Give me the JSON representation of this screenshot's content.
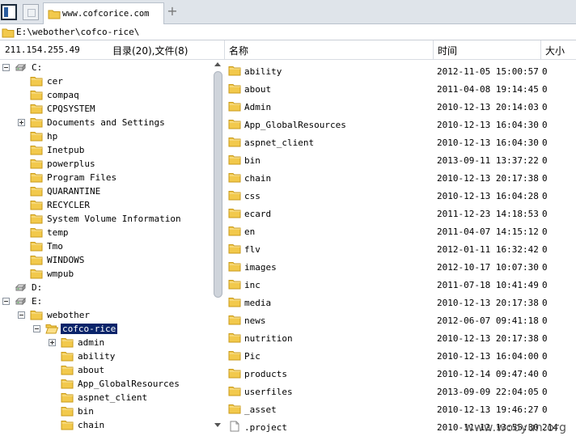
{
  "tab": {
    "title": "www.cofcorice.com",
    "add": "+"
  },
  "address": {
    "path": "E:\\webother\\cofco-rice\\"
  },
  "header": {
    "ip": "211.154.255.49",
    "counts": "目录(20),文件(8)",
    "col_name": "名称",
    "col_time": "时间",
    "col_size": "大小"
  },
  "tree": [
    {
      "label": "C:",
      "icon": "drive-icon",
      "x": 4,
      "level": 0,
      "expander": "minus"
    },
    {
      "label": "cer",
      "icon": "folder-icon",
      "level": 1
    },
    {
      "label": "compaq",
      "icon": "folder-icon",
      "level": 1
    },
    {
      "label": "CPQSYSTEM",
      "icon": "folder-icon",
      "level": 1
    },
    {
      "label": "Documents and Settings",
      "icon": "folder-icon",
      "level": 1,
      "expander": "plus"
    },
    {
      "label": "hp",
      "icon": "folder-icon",
      "level": 1
    },
    {
      "label": "Inetpub",
      "icon": "folder-icon",
      "level": 1
    },
    {
      "label": "powerplus",
      "icon": "folder-icon",
      "level": 1
    },
    {
      "label": "Program Files",
      "icon": "folder-icon",
      "level": 1
    },
    {
      "label": "QUARANTINE",
      "icon": "folder-icon",
      "level": 1
    },
    {
      "label": "RECYCLER",
      "icon": "folder-icon",
      "level": 1
    },
    {
      "label": "System Volume Information",
      "icon": "folder-icon",
      "level": 1
    },
    {
      "label": "temp",
      "icon": "folder-icon",
      "level": 1
    },
    {
      "label": "Tmo",
      "icon": "folder-icon",
      "level": 1
    },
    {
      "label": "WINDOWS",
      "icon": "folder-icon",
      "level": 1
    },
    {
      "label": "wmpub",
      "icon": "folder-icon",
      "level": 1
    },
    {
      "label": "D:",
      "icon": "drive-icon",
      "level": 0
    },
    {
      "label": "E:",
      "icon": "drive-icon",
      "level": 0,
      "expander": "minus"
    },
    {
      "label": "webother",
      "icon": "folder-icon",
      "level": 1,
      "expander": "minus"
    },
    {
      "label": "cofco-rice",
      "icon": "open-folder-icon",
      "level": 2,
      "expander": "minus",
      "selected": true
    },
    {
      "label": "admin",
      "icon": "folder-icon",
      "level": 3,
      "expander": "plus"
    },
    {
      "label": "ability",
      "icon": "folder-icon",
      "level": 3
    },
    {
      "label": "about",
      "icon": "folder-icon",
      "level": 3
    },
    {
      "label": "App_GlobalResources",
      "icon": "folder-icon",
      "level": 3
    },
    {
      "label": "aspnet_client",
      "icon": "folder-icon",
      "level": 3
    },
    {
      "label": "bin",
      "icon": "folder-icon",
      "level": 3
    },
    {
      "label": "chain",
      "icon": "folder-icon",
      "level": 3
    }
  ],
  "files": [
    {
      "name": "ability",
      "time": "2012-11-05 15:00:57",
      "size": "0",
      "icon": "folder-icon"
    },
    {
      "name": "about",
      "time": "2011-04-08 19:14:45",
      "size": "0",
      "icon": "folder-icon"
    },
    {
      "name": "Admin",
      "time": "2010-12-13 20:14:03",
      "size": "0",
      "icon": "folder-icon"
    },
    {
      "name": "App_GlobalResources",
      "time": "2010-12-13 16:04:30",
      "size": "0",
      "icon": "folder-icon"
    },
    {
      "name": "aspnet_client",
      "time": "2010-12-13 16:04:30",
      "size": "0",
      "icon": "folder-icon"
    },
    {
      "name": "bin",
      "time": "2013-09-11 13:37:22",
      "size": "0",
      "icon": "folder-icon"
    },
    {
      "name": "chain",
      "time": "2010-12-13 20:17:38",
      "size": "0",
      "icon": "folder-icon"
    },
    {
      "name": "css",
      "time": "2010-12-13 16:04:28",
      "size": "0",
      "icon": "folder-icon"
    },
    {
      "name": "ecard",
      "time": "2011-12-23 14:18:53",
      "size": "0",
      "icon": "folder-icon"
    },
    {
      "name": "en",
      "time": "2011-04-07 14:15:12",
      "size": "0",
      "icon": "folder-icon"
    },
    {
      "name": "flv",
      "time": "2012-01-11 16:32:42",
      "size": "0",
      "icon": "folder-icon"
    },
    {
      "name": "images",
      "time": "2012-10-17 10:07:30",
      "size": "0",
      "icon": "folder-icon"
    },
    {
      "name": "inc",
      "time": "2011-07-18 10:41:49",
      "size": "0",
      "icon": "folder-icon"
    },
    {
      "name": "media",
      "time": "2010-12-13 20:17:38",
      "size": "0",
      "icon": "folder-icon"
    },
    {
      "name": "news",
      "time": "2012-06-07 09:41:18",
      "size": "0",
      "icon": "folder-icon"
    },
    {
      "name": "nutrition",
      "time": "2010-12-13 20:17:38",
      "size": "0",
      "icon": "folder-icon"
    },
    {
      "name": "Pic",
      "time": "2010-12-13 16:04:00",
      "size": "0",
      "icon": "folder-icon"
    },
    {
      "name": "products",
      "time": "2010-12-14 09:47:40",
      "size": "0",
      "icon": "folder-icon"
    },
    {
      "name": "userfiles",
      "time": "2013-09-09 22:04:05",
      "size": "0",
      "icon": "folder-icon"
    },
    {
      "name": "_asset",
      "time": "2010-12-13 19:46:27",
      "size": "0",
      "icon": "folder-icon"
    },
    {
      "name": ".project",
      "time": "2010-11-12 13:55:30",
      "size": "214",
      "icon": "file-icon"
    }
  ],
  "watermark": "www.wooyun.org",
  "colors": {
    "folder": "#f2c94c",
    "folder_edge": "#c99a18",
    "selection": "#0a246a"
  }
}
